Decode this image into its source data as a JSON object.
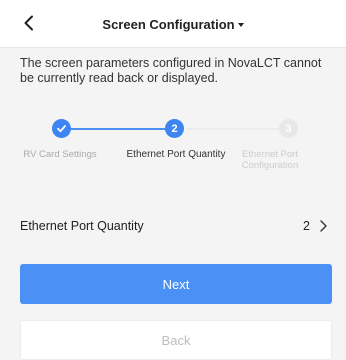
{
  "header": {
    "title": "Screen Configuration",
    "back_icon": "chevron-left-icon",
    "title_dropdown_icon": "caret-down-icon"
  },
  "notice": "The screen parameters configured in NovaLCT cannot be currently read back or displayed.",
  "stepper": {
    "steps": [
      {
        "label": "RV Card Settings",
        "status": "completed",
        "icon": "check-icon"
      },
      {
        "label": "Ethernet Port Quantity",
        "status": "current",
        "number": "2"
      },
      {
        "label": "Ethernet Port Configuration",
        "status": "pending",
        "number": "3"
      }
    ]
  },
  "settings_row": {
    "label": "Ethernet Port Quantity",
    "value": "2",
    "chevron_icon": "chevron-right-icon"
  },
  "buttons": {
    "next_label": "Next",
    "back_label": "Back"
  },
  "colors": {
    "accent": "#4a90f5",
    "active_dot": "#3d86f2",
    "pending_dot": "#e8e8e8",
    "background": "#f4f4f4",
    "header_bg": "#ffffff",
    "disabled_text": "#bdbdbd"
  }
}
